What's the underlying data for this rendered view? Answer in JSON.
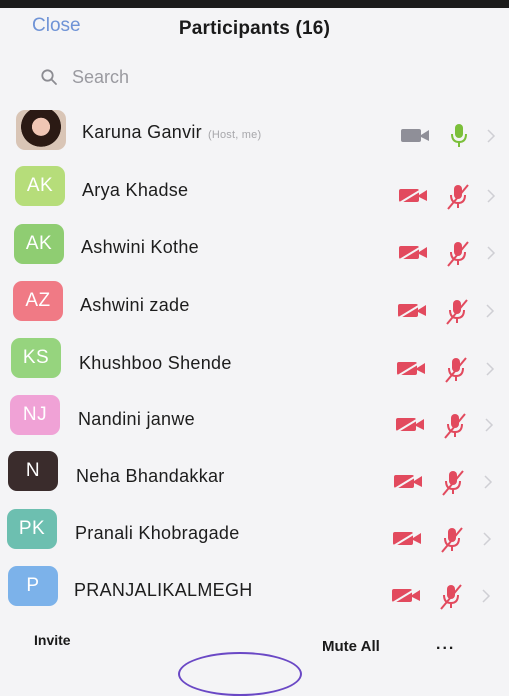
{
  "header": {
    "close_label": "Close",
    "title": "Participants (16)"
  },
  "search": {
    "placeholder": "Search"
  },
  "participants": [
    {
      "name": "Karuna Ganvir",
      "role": "(Host, me)",
      "initials": "",
      "color": "",
      "video": "off-gray",
      "audio": "on"
    },
    {
      "name": "Arya Khadse",
      "initials": "AK",
      "color": "#b6dd7a",
      "video": "off",
      "audio": "muted"
    },
    {
      "name": "Ashwini Kothe",
      "initials": "AK",
      "color": "#8fcd72",
      "video": "off",
      "audio": "muted"
    },
    {
      "name": "Ashwini zade",
      "initials": "AZ",
      "color": "#f07a85",
      "video": "off",
      "audio": "muted"
    },
    {
      "name": "Khushboo Shende",
      "initials": "KS",
      "color": "#96d47e",
      "video": "off",
      "audio": "muted"
    },
    {
      "name": "Nandini janwe",
      "initials": "NJ",
      "color": "#f0a2d6",
      "video": "off",
      "audio": "muted"
    },
    {
      "name": "Neha Bhandakkar",
      "initials": "N",
      "color": "#3a2c2c",
      "video": "off",
      "audio": "muted"
    },
    {
      "name": "Pranali Khobragade",
      "initials": "PK",
      "color": "#6dbfb0",
      "video": "off",
      "audio": "muted"
    },
    {
      "name": "PRANJALIKALMEGH",
      "initials": "P",
      "color": "#7cb2ea",
      "video": "off",
      "audio": "muted"
    }
  ],
  "footer": {
    "invite_label": "Invite",
    "mute_all_label": "Mute All",
    "more_label": "..."
  },
  "colors": {
    "accent": "#6f93d6",
    "muted_red": "#e24a5e",
    "mic_on_green": "#7bbf3a",
    "video_off_gray": "#8f8f98"
  },
  "icons": {
    "search": "search-icon",
    "video": "video-off-icon",
    "mic": "mic-icon",
    "chevron": "chevron-right-icon"
  }
}
